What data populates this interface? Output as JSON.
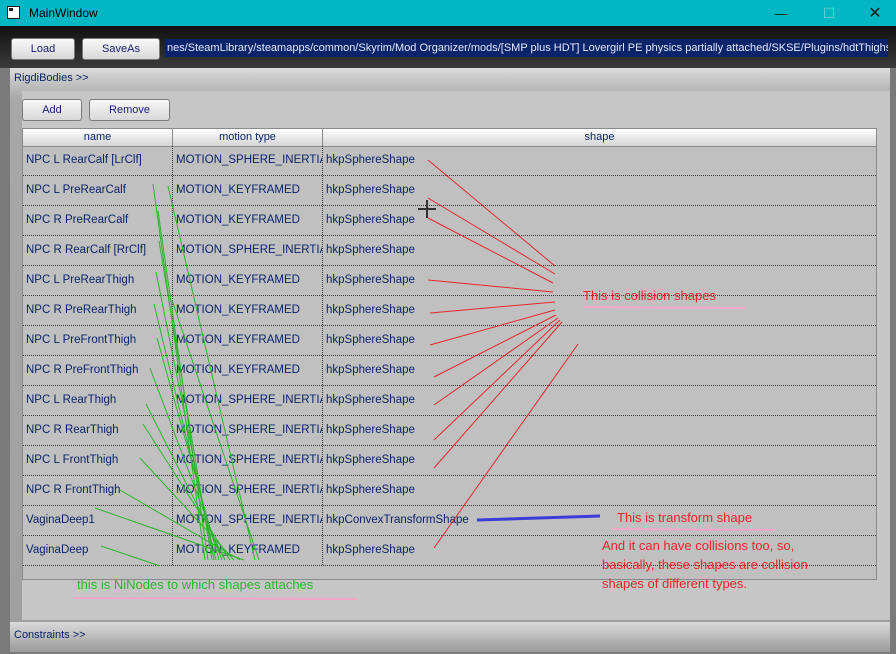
{
  "window": {
    "title": "MainWindow",
    "minimize_label": "—",
    "maximize_label": "☐",
    "close_label": "✕"
  },
  "toolbar": {
    "load_label": "Load",
    "saveas_label": "SaveAs",
    "path_value": "nes/SteamLibrary/steamapps/common/Skyrim/Mod Organizer/mods/[SMP plus HDT] Lovergirl PE physics partially attached/SKSE/Plugins/hdtThighs.xml"
  },
  "rigid_bodies": {
    "section_label": "RigdiBodies >>",
    "add_label": "Add",
    "remove_label": "Remove",
    "columns": [
      "name",
      "motion type",
      "shape"
    ],
    "rows": [
      [
        "NPC L RearCalf [LrClf]",
        "MOTION_SPHERE_INERTIA",
        "hkpSphereShape"
      ],
      [
        "NPC L PreRearCalf",
        "MOTION_KEYFRAMED",
        "hkpSphereShape"
      ],
      [
        "NPC R PreRearCalf",
        "MOTION_KEYFRAMED",
        "hkpSphereShape"
      ],
      [
        "NPC R RearCalf [RrClf]",
        "MOTION_SPHERE_INERTIA",
        "hkpSphereShape"
      ],
      [
        "NPC L PreRearThigh",
        "MOTION_KEYFRAMED",
        "hkpSphereShape"
      ],
      [
        "NPC R PreRearThigh",
        "MOTION_KEYFRAMED",
        "hkpSphereShape"
      ],
      [
        "NPC L PreFrontThigh",
        "MOTION_KEYFRAMED",
        "hkpSphereShape"
      ],
      [
        "NPC R PreFrontThigh",
        "MOTION_KEYFRAMED",
        "hkpSphereShape"
      ],
      [
        "NPC L RearThigh",
        "MOTION_SPHERE_INERTIA",
        "hkpSphereShape"
      ],
      [
        "NPC R RearThigh",
        "MOTION_SPHERE_INERTIA",
        "hkpSphereShape"
      ],
      [
        "NPC L FrontThigh",
        "MOTION_SPHERE_INERTIA",
        "hkpSphereShape"
      ],
      [
        "NPC R FrontThigh",
        "MOTION_SPHERE_INERTIA",
        "hkpSphereShape"
      ],
      [
        "VaginaDeep1",
        "MOTION_SPHERE_INERTIA",
        "hkpConvexTransformShape"
      ],
      [
        "VaginaDeep",
        "MOTION_KEYFRAMED",
        "hkpSphereShape"
      ]
    ]
  },
  "constraints": {
    "section_label": "Constraints >>"
  },
  "annotations": {
    "collision": "This is collision shapes",
    "transform": "This is transform shape",
    "collision_note": "And it can have collisions too, so, basically, these shapes are collision shapes of different types.",
    "ninodes": "this is NiNodes to which shapes attaches"
  },
  "colors": {
    "titlebar": "#00b7c3",
    "annotation_red": "#e8262a",
    "annotation_green": "#2bb52b",
    "annotation_blue": "#3b3bd6",
    "underline_pink": "#f4a8c8"
  }
}
